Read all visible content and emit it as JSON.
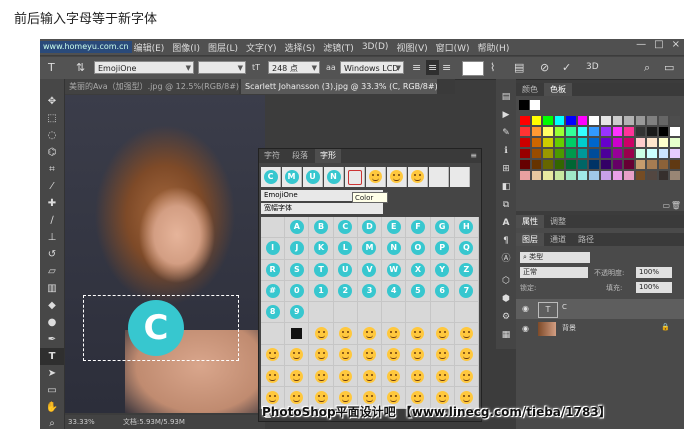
{
  "heading": "前后输入字母等于新字体",
  "menu": {
    "logo": "www.homeyu.com.cn",
    "items": [
      "编辑(E)",
      "图像(I)",
      "图层(L)",
      "文字(Y)",
      "选择(S)",
      "滤镜(T)",
      "3D(D)",
      "视图(V)",
      "窗口(W)",
      "帮助(H)"
    ],
    "min": "—",
    "max": "□",
    "close": "×"
  },
  "options": {
    "font": "EmojiOne",
    "size_icon": "tT",
    "size": "248 点",
    "antialias_icon": "aa",
    "antialias": "Windows LCD"
  },
  "tabs": [
    "美丽的Ava（加强型）.jpg @ 12.5%(RGB/8#)",
    "Scarlett Johansson (3).jpg @ 33.3% (C, RGB/8#) *"
  ],
  "canvas": {
    "glyph": "C"
  },
  "status": {
    "zoom": "33.33%",
    "doc": "文档:5.93M/5.93M"
  },
  "glyphs_panel": {
    "tabs": [
      "字符",
      "段落",
      "字形"
    ],
    "font": "EmojiOne",
    "style": "宽幅字体",
    "tooltip": "Color",
    "recent": [
      "C",
      "M",
      "U",
      "N"
    ],
    "letters": [
      "A",
      "B",
      "C",
      "D",
      "E",
      "F",
      "G",
      "H",
      "I",
      "J",
      "K",
      "L",
      "M",
      "N",
      "O",
      "P",
      "Q",
      "R",
      "S",
      "T",
      "U",
      "V",
      "W",
      "X",
      "Y",
      "Z",
      "#",
      "0",
      "1",
      "2",
      "3",
      "4",
      "5",
      "6",
      "7",
      "8",
      "9"
    ]
  },
  "swatch_panel": {
    "tabs": [
      "颜色",
      "色板"
    ]
  },
  "layers_panel": {
    "top_tabs": [
      "属性",
      "调整"
    ],
    "tabs": [
      "图层",
      "通道",
      "路径"
    ],
    "kind_placeholder": "类型",
    "blend": "正常",
    "opacity_label": "不透明度:",
    "opacity": "100%",
    "lock_label": "锁定:",
    "fill_label": "填充:",
    "fill": "100%",
    "layers": [
      {
        "name": "C",
        "type": "text"
      },
      {
        "name": "背景",
        "type": "image"
      }
    ]
  },
  "watermark": "PhotoShop平面设计吧 【www.linecg.com/tieba/1783】",
  "colors": {
    "accent": "#37c7cf",
    "emoji": "#ffc83d"
  }
}
